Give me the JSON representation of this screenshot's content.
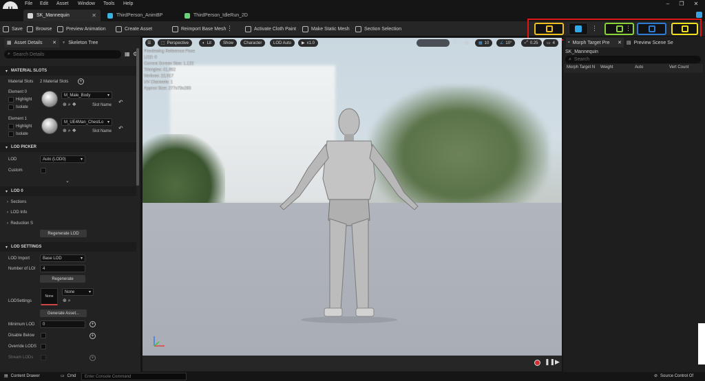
{
  "menu": [
    "File",
    "Edit",
    "Asset",
    "Window",
    "Tools",
    "Help"
  ],
  "tabs": [
    {
      "label": "SK_Mannequin",
      "color": "#d6d6d6"
    },
    {
      "label": "ThirdPerson_AnimBP",
      "color": "#3bb3e0"
    },
    {
      "label": "ThirdPerson_IdleRun_2D",
      "color": "#6bd17a"
    }
  ],
  "toolbar": {
    "save": "Save",
    "browse": "Browse",
    "preview_animation": "Preview Animation",
    "create_asset": "Create Asset",
    "reimport": "Reimport Base Mesh",
    "cloth": "Activate Cloth Paint",
    "static_mesh": "Make Static Mesh",
    "section_selection": "Section Selection"
  },
  "mode_colors": {
    "skeleton": "#f0c020",
    "mesh": "#2fa8e8",
    "animation": "#8ad43a",
    "blueprint": "#2f7bd8",
    "physics": "#f0e020"
  },
  "left": {
    "tab_details": "Asset Details",
    "tab_skeleton": "Skeleton Tree",
    "search_placeholder": "Search Details",
    "material_slots": {
      "header": "MATERIAL SLOTS",
      "label": "Material Slots",
      "count": "2 Material Slots",
      "elements": [
        {
          "label": "Element 0",
          "material": "M_Male_Body",
          "slot": "Slot Name"
        },
        {
          "label": "Element 1",
          "material": "M_UE4Man_ChestLo",
          "slot": "Slot Name"
        }
      ],
      "highlight": "Highlight",
      "isolate": "Isolate"
    },
    "lod_picker": {
      "header": "LOD PICKER",
      "lod_label": "LOD",
      "lod_value": "Auto (LOD0)",
      "custom": "Custom"
    },
    "lod0": {
      "header": "LOD 0",
      "sections": "Sections",
      "lod_info": "LOD Info",
      "reduction": "Reduction S",
      "regenerate": "Regenerate LOD"
    },
    "lod_settings": {
      "header": "LOD SETTINGS",
      "import_label": "LOD Import",
      "import_value": "Base LOD",
      "number_label": "Number of LOI",
      "number_value": "4",
      "regenerate": "Regenerate",
      "settings_label": "LODSettings",
      "thumb_text": "None",
      "settings_value": "None",
      "generate": "Generate Asset...",
      "min_lod_label": "Minimum LOD",
      "min_lod_value": "0",
      "disable_below": "Disable Below",
      "override_lods": "Override LODS",
      "stream_lods": "Stream LODs"
    }
  },
  "viewport": {
    "perspective": "Perspective",
    "lit": "Lit",
    "show": "Show",
    "character": "Character",
    "lod_auto": "LOD Auto",
    "speed": "x1.0",
    "grid": "10",
    "angle": "10°",
    "scale": "0.25",
    "cam": "4",
    "stats": [
      "Previewing Reference Pose",
      "LOD: 0",
      "Current Screen Size: 1.122",
      "Triangles: 41,952",
      "Vertices: 22,917",
      "UV Channels: 1",
      "Approx Size: 277x73x283"
    ]
  },
  "right": {
    "tab_morph": "Morph Target Pre",
    "tab_preview": "Preview Scene Se",
    "mesh_name": "SK_Mannequin",
    "search_placeholder": "Search",
    "columns": [
      "Morph Target N",
      "Weight",
      "Auto",
      "Vert Count"
    ]
  },
  "bottom": {
    "content_drawer": "Content Drawer",
    "cmd": "Cmd",
    "console_placeholder": "Enter Console Command",
    "source_control": "Source Control Of"
  }
}
